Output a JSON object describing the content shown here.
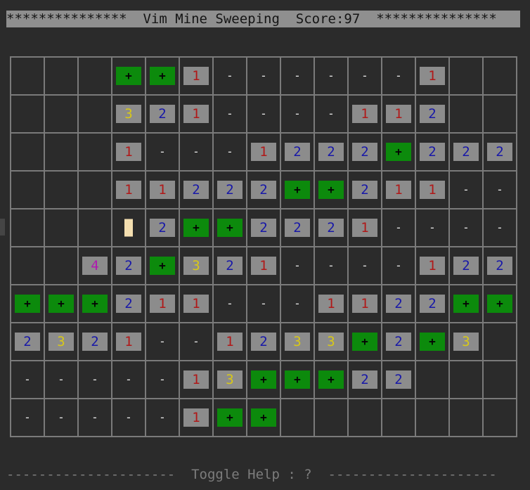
{
  "header": {
    "title_bar": "***************  Vim Mine Sweeping  Score:97  ***************"
  },
  "board": {
    "rows": [
      [
        "",
        "",
        "",
        "+",
        "+",
        "1",
        "-",
        "-",
        "-",
        "-",
        "-",
        "-",
        "1",
        "",
        ""
      ],
      [
        "",
        "",
        "",
        "3",
        "2",
        "1",
        "-",
        "-",
        "-",
        "-",
        "1",
        "1",
        "2",
        "",
        ""
      ],
      [
        "",
        "",
        "",
        "1",
        "-",
        "-",
        "-",
        "1",
        "2",
        "2",
        "2",
        "+",
        "2",
        "2",
        "2"
      ],
      [
        "",
        "",
        "",
        "1",
        "1",
        "2",
        "2",
        "2",
        "+",
        "+",
        "2",
        "1",
        "1",
        "-",
        "-"
      ],
      [
        "",
        "",
        "",
        "cursor",
        "2",
        "+",
        "+",
        "2",
        "2",
        "2",
        "1",
        "-",
        "-",
        "-",
        "-"
      ],
      [
        "",
        "",
        "4",
        "2",
        "+",
        "3",
        "2",
        "1",
        "-",
        "-",
        "-",
        "-",
        "1",
        "2",
        "2"
      ],
      [
        "+",
        "+",
        "+",
        "2",
        "1",
        "1",
        "-",
        "-",
        "-",
        "1",
        "1",
        "2",
        "2",
        "+",
        "+"
      ],
      [
        "2",
        "3",
        "2",
        "1",
        "-",
        "-",
        "1",
        "2",
        "3",
        "3",
        "+",
        "2",
        "+",
        "3",
        ""
      ],
      [
        "-",
        "-",
        "-",
        "-",
        "-",
        "1",
        "3",
        "+",
        "+",
        "+",
        "2",
        "2",
        "",
        "",
        ""
      ],
      [
        "-",
        "-",
        "-",
        "-",
        "-",
        "1",
        "+",
        "+",
        "",
        "",
        "",
        "",
        "",
        "",
        ""
      ]
    ]
  },
  "colors": {
    "background": "#2b2b2b",
    "number_tile": "#8c8c8c",
    "flag_tile": "#0c8a0c",
    "n1": "#b01818",
    "n2": "#1818a8",
    "n3": "#d8c818",
    "n4": "#b018b0"
  },
  "footer": {
    "help_line": "---------------------  Toggle Help : ?  ---------------------"
  }
}
